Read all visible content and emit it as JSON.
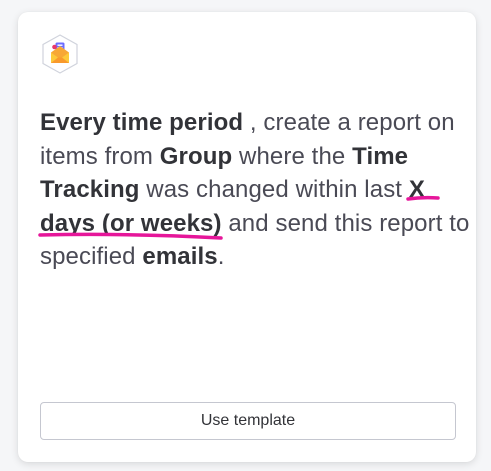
{
  "card": {
    "icon": "envelope-report-icon",
    "recipe": [
      {
        "id": "r0",
        "text": "Every time period",
        "kind": "field"
      },
      {
        "id": "r1",
        "text": " , create a report on items from ",
        "kind": "plain"
      },
      {
        "id": "r2",
        "text": "Group",
        "kind": "field"
      },
      {
        "id": "r3",
        "text": " where the ",
        "kind": "plain"
      },
      {
        "id": "r4",
        "text": "Time Tracking",
        "kind": "field"
      },
      {
        "id": "r5",
        "text": " was changed within last ",
        "kind": "plain"
      },
      {
        "id": "r6",
        "text": "X days (or weeks)",
        "kind": "field"
      },
      {
        "id": "r7",
        "text": " and send this report to specified ",
        "kind": "plain"
      },
      {
        "id": "r8",
        "text": "emails",
        "kind": "field"
      },
      {
        "id": "r9",
        "text": ".",
        "kind": "plain"
      }
    ],
    "button_label": "Use template"
  },
  "colors": {
    "highlight_ink": "#e6169a",
    "field_text": "#323338",
    "plain_text": "#4a4a55"
  }
}
